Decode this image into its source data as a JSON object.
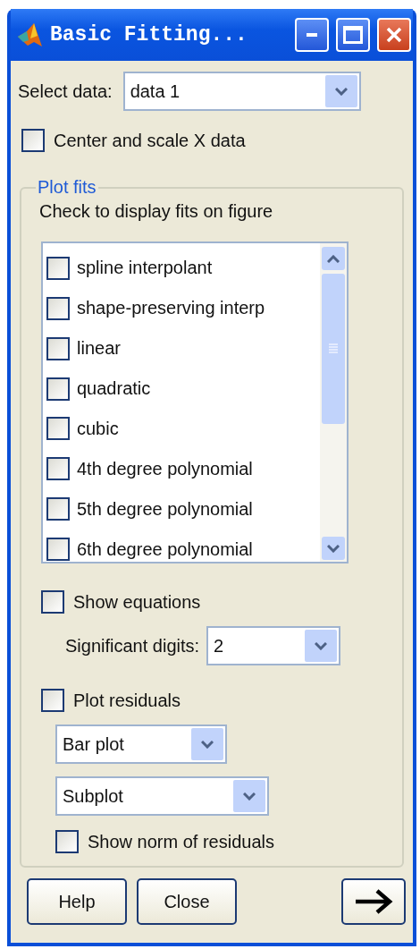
{
  "window": {
    "title": "Basic Fitting..."
  },
  "select_data": {
    "label": "Select data:",
    "value": "data 1"
  },
  "center_scale": {
    "label": "Center and scale X data",
    "checked": false
  },
  "plot_fits": {
    "title": "Plot fits",
    "instruction": "Check to display fits on figure",
    "fits": [
      {
        "label": "spline interpolant",
        "checked": false
      },
      {
        "label": "shape-preserving interp",
        "checked": false
      },
      {
        "label": "linear",
        "checked": false
      },
      {
        "label": "quadratic",
        "checked": false
      },
      {
        "label": "cubic",
        "checked": false
      },
      {
        "label": "4th degree polynomial",
        "checked": false
      },
      {
        "label": "5th degree polynomial",
        "checked": false
      },
      {
        "label": "6th degree polynomial",
        "checked": false
      }
    ],
    "show_equations": {
      "label": "Show equations",
      "checked": false
    },
    "significant_digits": {
      "label": "Significant digits:",
      "value": "2"
    },
    "plot_residuals": {
      "label": "Plot residuals",
      "checked": false
    },
    "residual_type": {
      "value": "Bar plot"
    },
    "residual_location": {
      "value": "Subplot"
    },
    "show_norm": {
      "label": "Show norm of residuals",
      "checked": false
    }
  },
  "buttons": [
    "Help",
    "Close"
  ]
}
